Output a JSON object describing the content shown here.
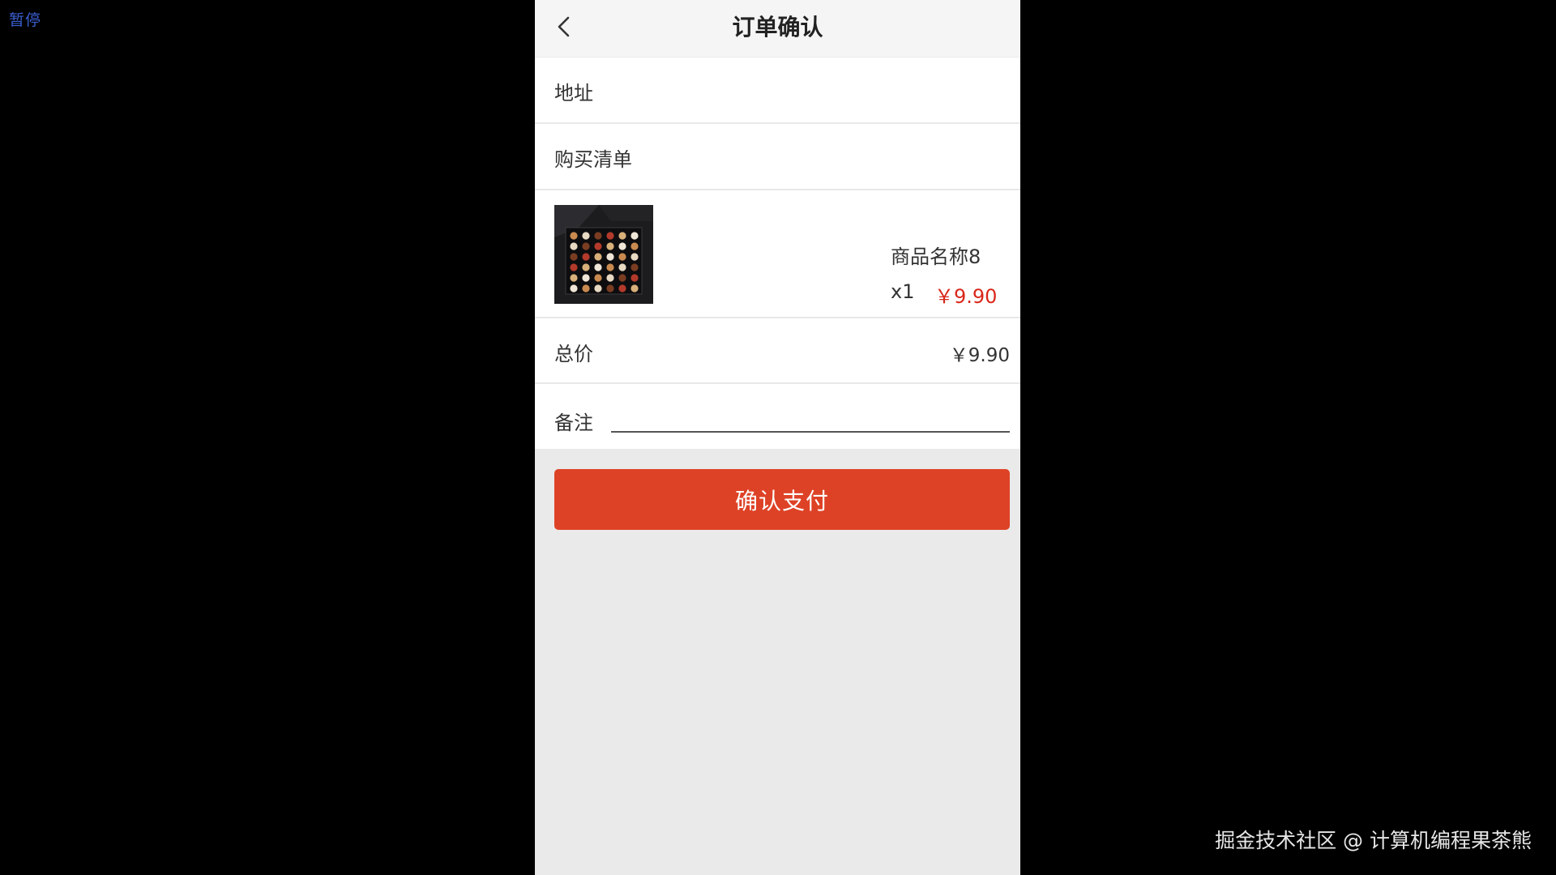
{
  "overlay": {
    "pause_label": "暂停",
    "watermark": "掘金技术社区 @ 计算机编程果茶熊"
  },
  "header": {
    "title": "订单确认",
    "back_icon": "chevron-left-icon"
  },
  "address": {
    "label": "地址"
  },
  "purchase_list": {
    "label": "购买清单"
  },
  "product": {
    "name": "商品名称8",
    "quantity": "x1",
    "price": "￥9.90",
    "thumbnail": "chocolate-box-image"
  },
  "total": {
    "label": "总价",
    "value": "￥9.90"
  },
  "note": {
    "label": "备注",
    "value": "",
    "placeholder": ""
  },
  "actions": {
    "pay_label": "确认支付"
  },
  "colors": {
    "accent": "#de4226",
    "price": "#d9271a",
    "page_background": "#eaeaea",
    "outer_background": "#000000"
  }
}
